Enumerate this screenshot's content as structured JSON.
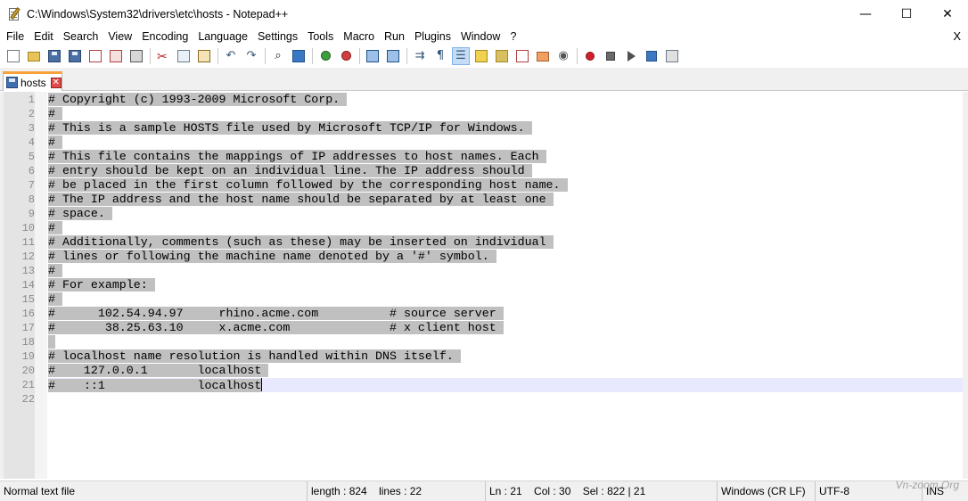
{
  "window": {
    "title": "C:\\Windows\\System32\\drivers\\etc\\hosts - Notepad++",
    "minimize_glyph": "—",
    "maximize_glyph": "☐",
    "close_glyph": "✕"
  },
  "menu": {
    "items": [
      "File",
      "Edit",
      "Search",
      "View",
      "Encoding",
      "Language",
      "Settings",
      "Tools",
      "Macro",
      "Run",
      "Plugins",
      "Window",
      "?"
    ],
    "close_label": "X"
  },
  "toolbar": {
    "icons": [
      "new-file-icon",
      "open-folder-icon",
      "save-icon",
      "save-all-icon",
      "close-icon",
      "close-all-icon",
      "print-icon",
      "cut-icon",
      "copy-icon",
      "paste-icon",
      "undo-icon",
      "redo-icon",
      "find-icon",
      "replace-icon",
      "zoom-in-icon",
      "zoom-out-icon",
      "sync-vertical-icon",
      "sync-horizontal-icon",
      "word-wrap-icon",
      "show-all-characters-icon",
      "indent-guide-icon",
      "user-language-icon",
      "document-map-icon",
      "function-list-icon",
      "folder-as-workspace-icon",
      "monitoring-icon",
      "record-macro-icon",
      "stop-recording-icon",
      "playback-macro-icon",
      "run-macro-multiple-icon",
      "save-macro-icon"
    ]
  },
  "tab": {
    "label": "hosts",
    "close_glyph": "✕"
  },
  "editor": {
    "accent_current_line": "#e8e8ff",
    "selection_color": "#c0c0c0",
    "lines": [
      "# Copyright (c) 1993-2009 Microsoft Corp.",
      "#",
      "# This is a sample HOSTS file used by Microsoft TCP/IP for Windows.",
      "#",
      "# This file contains the mappings of IP addresses to host names. Each",
      "# entry should be kept on an individual line. The IP address should",
      "# be placed in the first column followed by the corresponding host name.",
      "# The IP address and the host name should be separated by at least one",
      "# space.",
      "#",
      "# Additionally, comments (such as these) may be inserted on individual",
      "# lines or following the machine name denoted by a '#' symbol.",
      "#",
      "# For example:",
      "#",
      "#      102.54.94.97     rhino.acme.com          # source server",
      "#       38.25.63.10     x.acme.com              # x client host",
      "",
      "# localhost name resolution is handled within DNS itself.",
      "#\t127.0.0.1       localhost",
      "#\t::1             localhost",
      ""
    ]
  },
  "status": {
    "file_type": "Normal text file",
    "length": "length : 824",
    "lines": "lines : 22",
    "ln": "Ln : 21",
    "col": "Col : 30",
    "sel": "Sel : 822 | 21",
    "eol": "Windows (CR LF)",
    "encoding": "UTF-8",
    "mode": "INS"
  },
  "watermark": "Vn-zoom.Org"
}
